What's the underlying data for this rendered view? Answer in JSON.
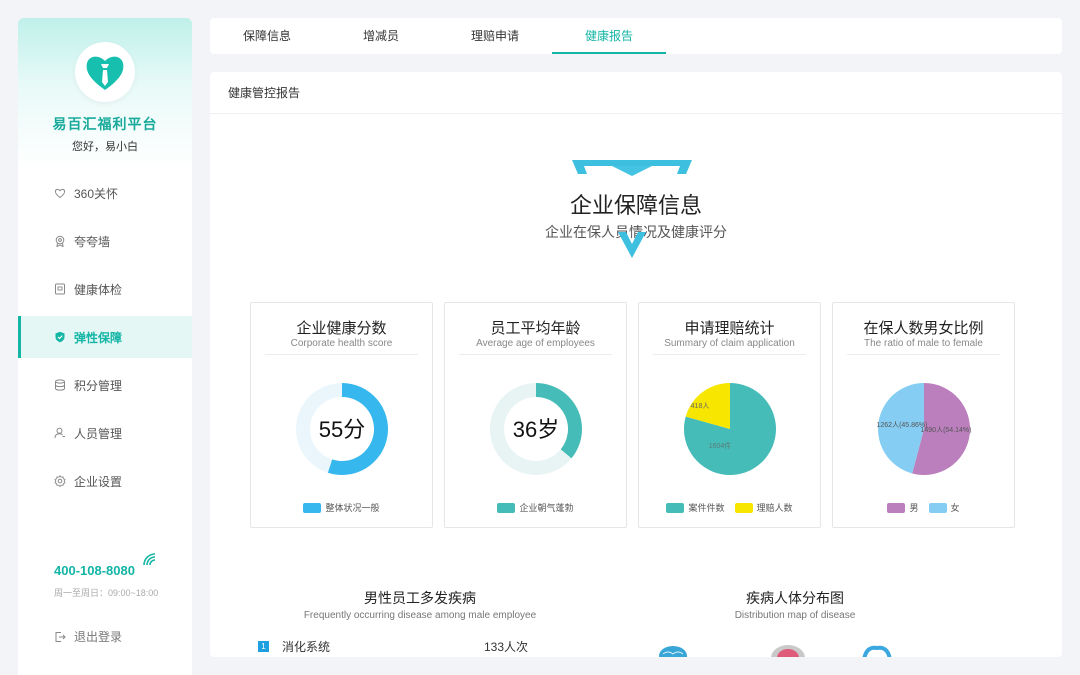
{
  "sidebar": {
    "brand": "易百汇福利平台",
    "greeting": "您好，易小白",
    "items": [
      {
        "label": "360关怀",
        "icon": "heart-icon"
      },
      {
        "label": "夸夸墙",
        "icon": "award-icon"
      },
      {
        "label": "健康体检",
        "icon": "report-icon"
      },
      {
        "label": "弹性保障",
        "icon": "shield-icon",
        "active": true
      },
      {
        "label": "积分管理",
        "icon": "database-icon"
      },
      {
        "label": "人员管理",
        "icon": "user-icon"
      },
      {
        "label": "企业设置",
        "icon": "gear-icon"
      }
    ],
    "phone": "400-108-8080",
    "hours": "周一至周日：09:00~18:00",
    "logout": "退出登录"
  },
  "tabs": [
    {
      "label": "保障信息"
    },
    {
      "label": "增减员"
    },
    {
      "label": "理赔申请"
    },
    {
      "label": "健康报告",
      "active": true
    }
  ],
  "panel": {
    "title": "健康管控报告",
    "hero_title": "企业保障信息",
    "hero_subtitle": "企业在保人员情况及健康评分"
  },
  "cards": [
    {
      "title": "企业健康分数",
      "subtitle": "Corporate health score",
      "center_text": "55分",
      "legend": [
        "整体状况一般"
      ]
    },
    {
      "title": "员工平均年龄",
      "subtitle": "Average age of employees",
      "center_text": "36岁",
      "legend": [
        "企业朝气蓬勃"
      ]
    },
    {
      "title": "申请理赔统计",
      "subtitle": "Summary of claim application",
      "legend": [
        "案件件数",
        "理赔人数"
      ],
      "label_a": "1604件",
      "label_b": "418人"
    },
    {
      "title": "在保人数男女比例",
      "subtitle": "The ratio of male to female",
      "legend": [
        "男",
        "女"
      ],
      "label_a": "1262人(45.86%)",
      "label_b": "1490人(54.14%)"
    }
  ],
  "chart_data": [
    {
      "type": "pie",
      "title": "企业健康分数",
      "categories": [
        "整体状况一般",
        ""
      ],
      "values": [
        55,
        45
      ],
      "colors": [
        "#36b8ee",
        "#eaf6fc"
      ],
      "donut": true
    },
    {
      "type": "pie",
      "title": "员工平均年龄",
      "categories": [
        "企业朝气蓬勃",
        ""
      ],
      "values": [
        36,
        64
      ],
      "colors": [
        "#45bcb7",
        "#e7f4f3"
      ],
      "donut": true
    },
    {
      "type": "pie",
      "title": "申请理赔统计",
      "categories": [
        "案件件数",
        "理赔人数"
      ],
      "values": [
        1604,
        418
      ],
      "colors": [
        "#45bcb7",
        "#f7e600"
      ]
    },
    {
      "type": "pie",
      "title": "在保人数男女比例",
      "categories": [
        "男",
        "女"
      ],
      "values": [
        1490,
        1262
      ],
      "colors": [
        "#bb7fbd",
        "#86cdf3"
      ]
    }
  ],
  "section_left": {
    "title": "男性员工多发疾病",
    "subtitle": "Frequently occurring disease among male employee"
  },
  "section_right": {
    "title": "疾病人体分布图",
    "subtitle": "Distribution map of disease"
  },
  "disease_list": [
    {
      "rank": "1",
      "name": "消化系统",
      "count": "133人次"
    }
  ]
}
